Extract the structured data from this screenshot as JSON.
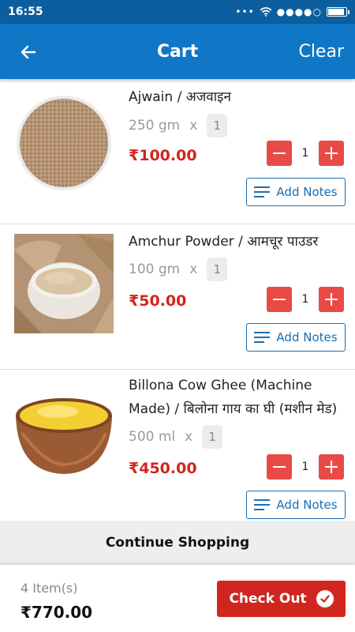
{
  "status_bar": {
    "time": "16:55",
    "signal_dots": "●●●●○"
  },
  "header": {
    "title": "Cart",
    "clear_label": "Clear"
  },
  "items": [
    {
      "name": "Ajwain / अजवाइन",
      "size": "250 gm",
      "multiplier": "x",
      "pack_qty": "1",
      "price": "₹100.00",
      "quantity": "1",
      "notes_label": "Add Notes",
      "image": "ajwain-seeds-bowl"
    },
    {
      "name": "Amchur Powder / आमचूर पाउडर",
      "size": "100 gm",
      "multiplier": "x",
      "pack_qty": "1",
      "price": "₹50.00",
      "quantity": "1",
      "notes_label": "Add Notes",
      "image": "amchur-powder-bowl"
    },
    {
      "name": "Billona Cow Ghee (Machine Made) / बिलोना गाय का घी (मशीन मेड)",
      "size": "500 ml",
      "multiplier": "x",
      "pack_qty": "1",
      "price": "₹450.00",
      "quantity": "1",
      "notes_label": "Add Notes",
      "image": "ghee-wooden-bowl"
    }
  ],
  "continue_label": "Continue Shopping",
  "footer": {
    "item_count": "4 Item(s)",
    "total": "₹770.00",
    "checkout_label": "Check Out"
  },
  "colors": {
    "status_bar": "#0c5e9e",
    "app_bar": "#1077c6",
    "price_red": "#d0261f",
    "stepper_red": "#e84b45",
    "notes_blue": "#1a6fb3"
  }
}
